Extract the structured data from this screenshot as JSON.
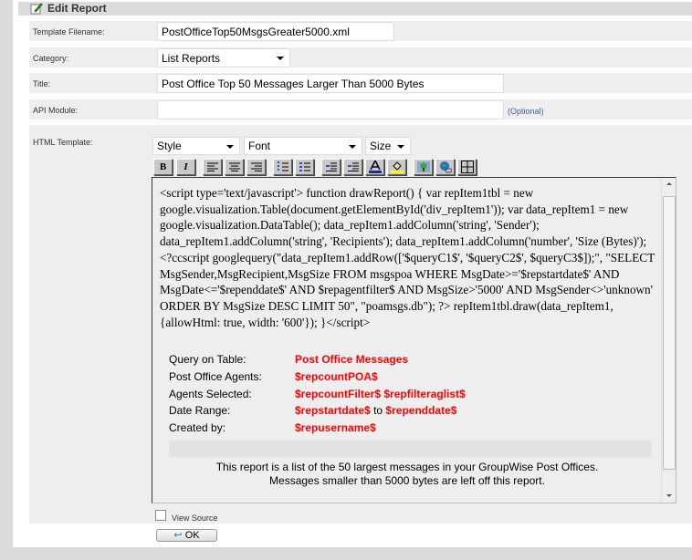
{
  "header": {
    "title": "Edit Report"
  },
  "form": {
    "filename_label": "Template Filename:",
    "filename_value": "PostOfficeTop50MsgsGreater5000.xml",
    "category_label": "Category:",
    "category_value": "List Reports",
    "title_label": "Title:",
    "title_value": "Post Office Top 50 Messages Larger Than 5000 Bytes",
    "api_label": "API Module:",
    "api_value": "",
    "api_hint": "(Optional)",
    "html_label": "HTML Template:"
  },
  "toolbar": {
    "style": "Style",
    "font": "Font",
    "size": "Size",
    "bold": "B",
    "italic": "I"
  },
  "editor": {
    "code": "<script type='text/javascript'> function drawReport() { var repItem1tbl = new google.visualization.Table(document.getElementById('div_repItem1')); var data_repItem1 = new google.visualization.DataTable(); data_repItem1.addColumn('string', 'Sender'); data_repItem1.addColumn('string', 'Recipients'); data_repItem1.addColumn('number', 'Size (Bytes)');<?ccscript googlequery(\"data_repItem1.addRow(['$queryC1$', '$queryC2$', $queryC3$]);\", \"SELECT MsgSender,MsgRecipient,MsgSize FROM msgspoa WHERE MsgDate>='$repstartdate$' AND MsgDate<='$rependdate$' AND $repagentfilter$ AND MsgSize>'5000' AND MsgSender<>'unknown' ORDER BY MsgSize DESC LIMIT 50\", \"poamsgs.db\"); ?> repItem1tbl.draw(data_repItem1, {allowHtml: true, width: '600'}); }</script>",
    "info": [
      {
        "label": "Query on Table:",
        "value": "Post Office Messages"
      },
      {
        "label": "Post Office Agents:",
        "value": "$repcountPOA$"
      },
      {
        "label": "Agents Selected:",
        "value": "$repcountFilter$ $repfilteraglist$"
      },
      {
        "label": "Date Range:",
        "value": "$repstartdate$",
        "to": "to",
        "value2": "$rependdate$"
      },
      {
        "label": "Created by:",
        "value": "$repusername$"
      }
    ],
    "desc1": "This report is a list of the 50 largest messages in your GroupWise Post Offices.",
    "desc2": "Messages smaller than 5000 bytes are left off this report."
  },
  "view_source": "View Source",
  "ok": "OK"
}
